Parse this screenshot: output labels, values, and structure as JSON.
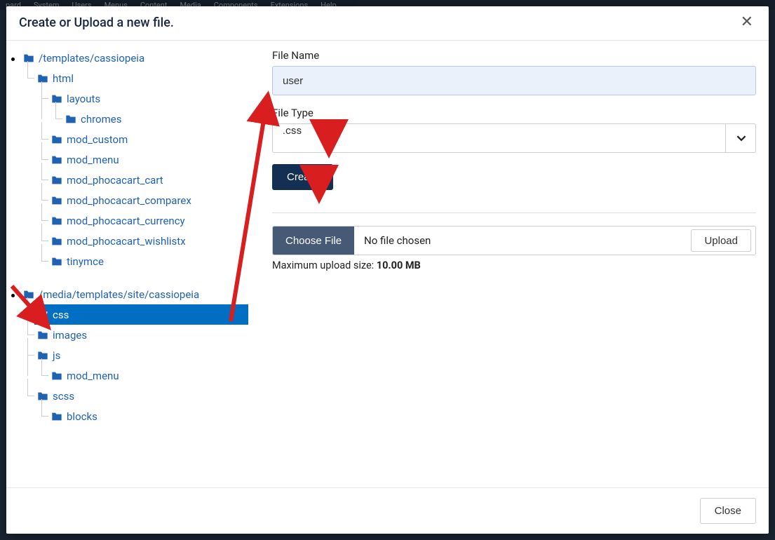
{
  "backdrop": {
    "menu": [
      "pard",
      "System",
      "Users",
      "Menus",
      "Content",
      "Media",
      "Components",
      "Extensions",
      "Help"
    ]
  },
  "modal": {
    "title": "Create or Upload a new file.",
    "close_btn": "Close"
  },
  "tree": {
    "root1": {
      "label": "/templates/cassiopeia",
      "children": {
        "html": {
          "label": "html",
          "children": {
            "layouts": {
              "label": "layouts",
              "children": {
                "chromes": {
                  "label": "chromes"
                }
              }
            },
            "mod_custom": {
              "label": "mod_custom"
            },
            "mod_menu": {
              "label": "mod_menu"
            },
            "mod_phocacart_cart": {
              "label": "mod_phocacart_cart"
            },
            "mod_phocacart_comparex": {
              "label": "mod_phocacart_comparex"
            },
            "mod_phocacart_currency": {
              "label": "mod_phocacart_currency"
            },
            "mod_phocacart_wishlistx": {
              "label": "mod_phocacart_wishlistx"
            },
            "tinymce": {
              "label": "tinymce"
            }
          }
        }
      }
    },
    "root2": {
      "label": "/media/templates/site/cassiopeia",
      "children": {
        "css": {
          "label": "css",
          "selected": true
        },
        "images": {
          "label": "images"
        },
        "js": {
          "label": "js",
          "children": {
            "mod_menu": {
              "label": "mod_menu"
            }
          }
        },
        "scss": {
          "label": "scss",
          "children": {
            "blocks": {
              "label": "blocks"
            }
          }
        }
      }
    }
  },
  "form": {
    "filename_label": "File Name",
    "filename_value": "user",
    "filetype_label": "File Type",
    "filetype_value": ".css",
    "create_btn": "Create",
    "choose_file_btn": "Choose File",
    "no_file": "No file chosen",
    "upload_btn": "Upload",
    "max_upload_prefix": "Maximum upload size: ",
    "max_upload_size": "10.00 MB"
  }
}
